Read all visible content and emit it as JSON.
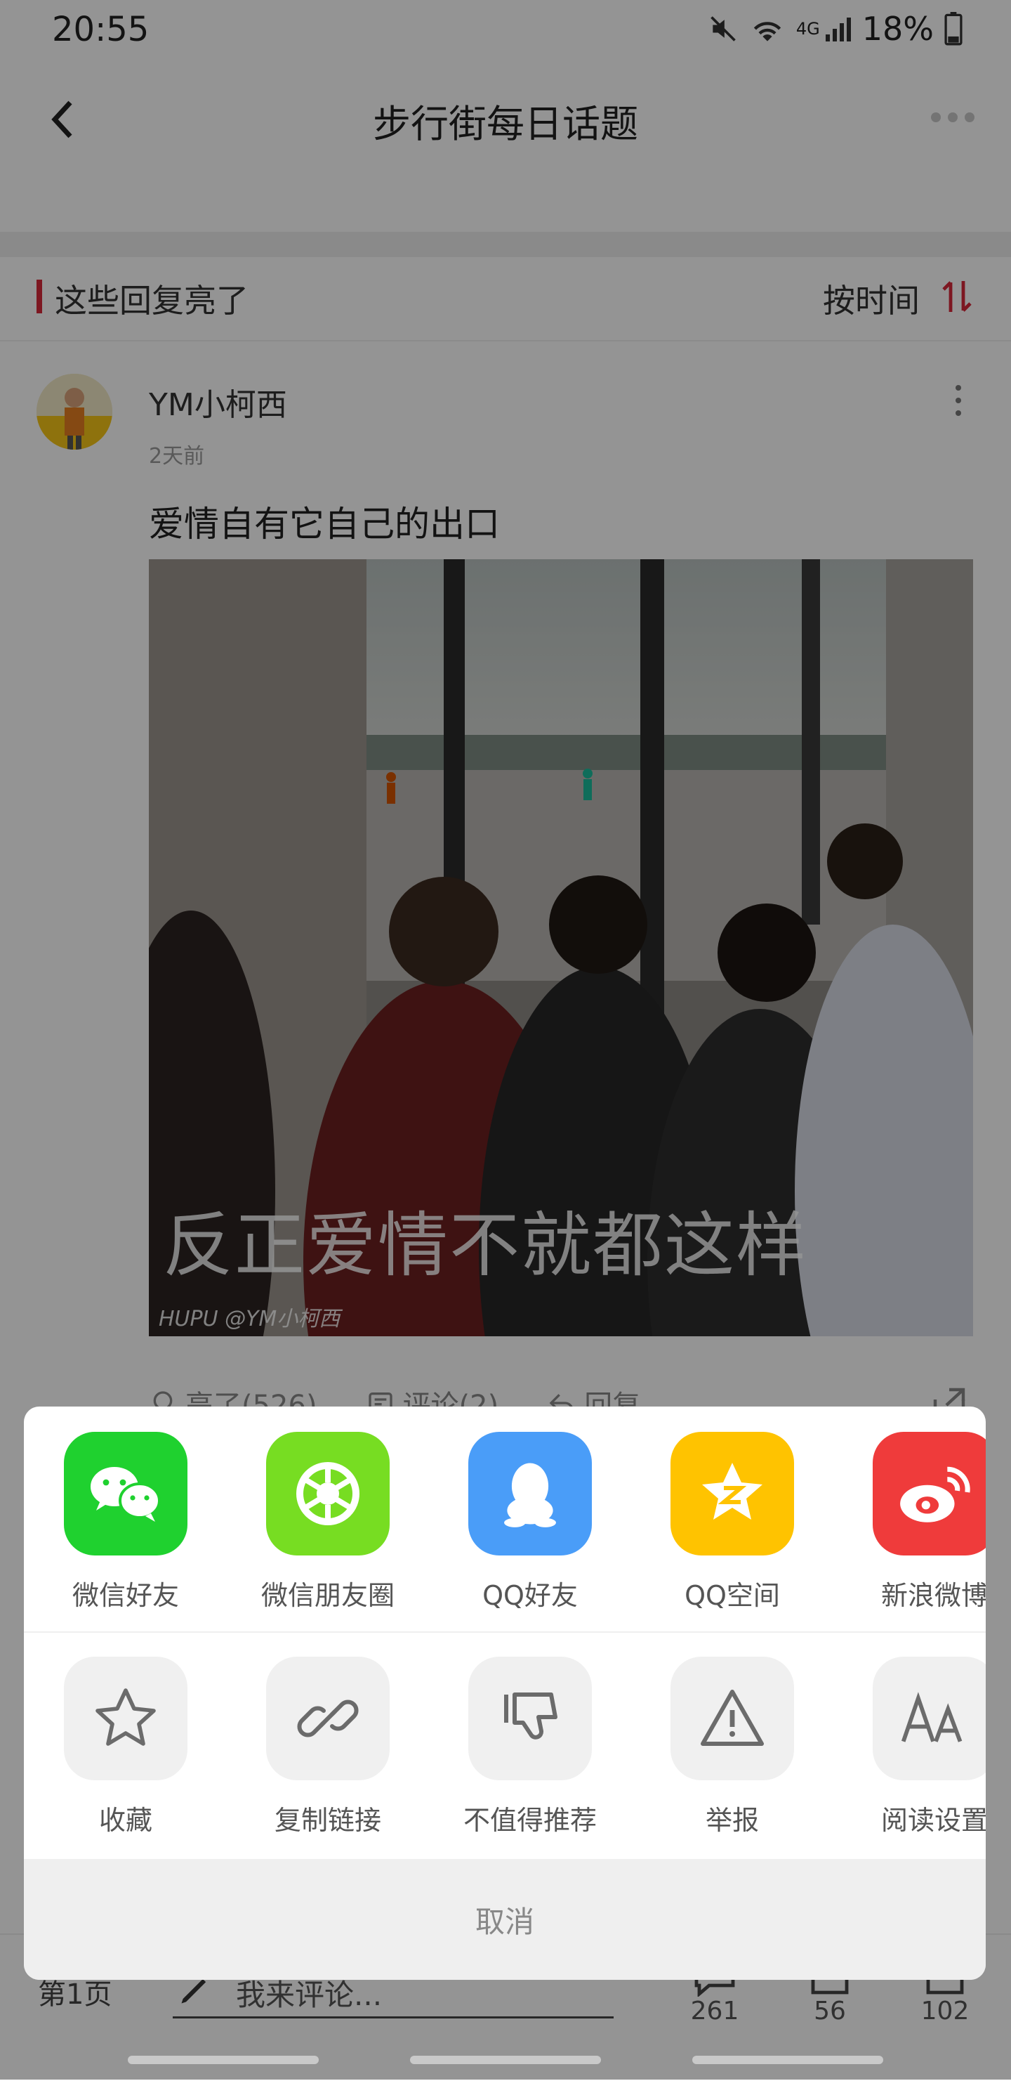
{
  "status": {
    "time": "20:55",
    "network": "4G",
    "battery": "18%"
  },
  "header": {
    "title": "步行街每日话题"
  },
  "section": {
    "title": "这些回复亮了",
    "sort_label": "按时间"
  },
  "post": {
    "username": "YM小柯西",
    "time": "2天前",
    "text": "爱情自有它自己的出口",
    "image_caption": "反正爱情不就都这样",
    "image_watermark": "HUPU @YM小柯西",
    "actions": {
      "light": "亮了(526)",
      "comment": "评论(2)",
      "reply": "回复"
    }
  },
  "bottom": {
    "page": "第1页",
    "input_placeholder": "我来评论...",
    "counts": {
      "comments": "261",
      "favorites": "56",
      "shares": "102"
    }
  },
  "share_sheet": {
    "share_targets": [
      {
        "label": "微信好友",
        "icon": "wechat-icon",
        "color": "#1fd12f"
      },
      {
        "label": "微信朋友圈",
        "icon": "moments-icon",
        "color": "#77dd22"
      },
      {
        "label": "QQ好友",
        "icon": "qq-icon",
        "color": "#4a9df8"
      },
      {
        "label": "QQ空间",
        "icon": "qzone-icon",
        "color": "#ffc300"
      },
      {
        "label": "新浪微博",
        "icon": "weibo-icon",
        "color": "#ef3b3b"
      }
    ],
    "tools": [
      {
        "label": "收藏",
        "icon": "star-icon"
      },
      {
        "label": "复制链接",
        "icon": "link-icon"
      },
      {
        "label": "不值得推荐",
        "icon": "thumbs-down-icon"
      },
      {
        "label": "举报",
        "icon": "warning-icon"
      },
      {
        "label": "阅读设置",
        "icon": "font-size-icon"
      }
    ],
    "cancel": "取消"
  },
  "colors": {
    "accent": "#d8293a",
    "overlay": "rgba(0,0,0,0.42)"
  }
}
